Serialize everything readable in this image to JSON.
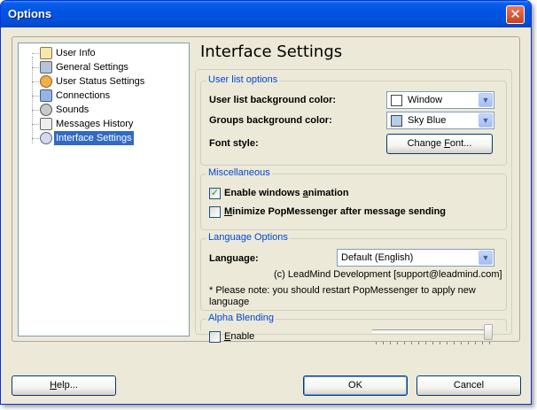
{
  "window": {
    "title": "Options"
  },
  "tree": {
    "items": [
      {
        "label": "User Info",
        "icon": "user-card-icon",
        "selected": false
      },
      {
        "label": "General Settings",
        "icon": "sliders-icon",
        "selected": false
      },
      {
        "label": "User Status Settings",
        "icon": "user-status-icon",
        "selected": false
      },
      {
        "label": "Connections",
        "icon": "connections-icon",
        "selected": false
      },
      {
        "label": "Sounds",
        "icon": "music-note-icon",
        "selected": false
      },
      {
        "label": "Messages History",
        "icon": "history-icon",
        "selected": false
      },
      {
        "label": "Interface Settings",
        "icon": "interface-settings-icon",
        "selected": true
      }
    ]
  },
  "page": {
    "title": "Interface Settings",
    "user_list": {
      "group_title": "User list options",
      "bg_color_label": "User list background color:",
      "bg_color_value": "Window",
      "bg_color_swatch": "#ffffff",
      "groups_color_label": "Groups background color:",
      "groups_color_value": "Sky Blue",
      "groups_color_swatch": "#b4cdea",
      "font_style_label": "Font style:",
      "change_font_button": "Change Font..."
    },
    "misc": {
      "group_title": "Miscellaneous",
      "enable_animation": {
        "label": "Enable windows animation",
        "checked": true
      },
      "minimize_after_send": {
        "label": "Minimize PopMessenger after message sending",
        "checked": false
      }
    },
    "language": {
      "group_title": "Language Options",
      "label": "Language:",
      "value": "Default (English)",
      "credit": "(c) LeadMind Development [support@leadmind.com]",
      "note": "* Please note:  you should restart PopMessenger to apply new language"
    },
    "alpha": {
      "group_title": "Alpha Blending",
      "enable": {
        "label": "Enable",
        "checked": false
      },
      "slider_value": 1.0
    }
  },
  "footer": {
    "help_button": "Help...",
    "ok_button": "OK",
    "cancel_button": "Cancel"
  },
  "colors": {
    "title_bar": "#0054e3",
    "dialog_bg": "#ece9d8",
    "group_title": "#0046d5",
    "selection": "#316ac5"
  }
}
